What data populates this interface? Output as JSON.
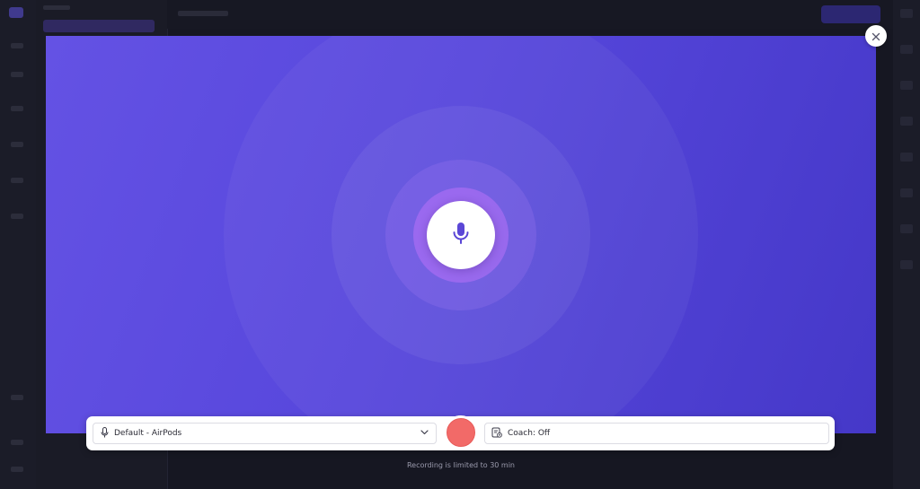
{
  "recorder": {
    "microphone_select": {
      "selected": "Default - AirPods"
    },
    "coach": {
      "label": "Coach: Off"
    },
    "limit_note": "Recording is limited to 30 min"
  },
  "icons": {
    "mic": "microphone-icon",
    "close": "close-icon",
    "chevron": "chevron-down-icon",
    "coach": "coach-icon"
  },
  "colors": {
    "stage_start": "#6452e4",
    "stage_end": "#4538c8",
    "record": "#f26a68",
    "mic_accent": "#5b47d6"
  }
}
